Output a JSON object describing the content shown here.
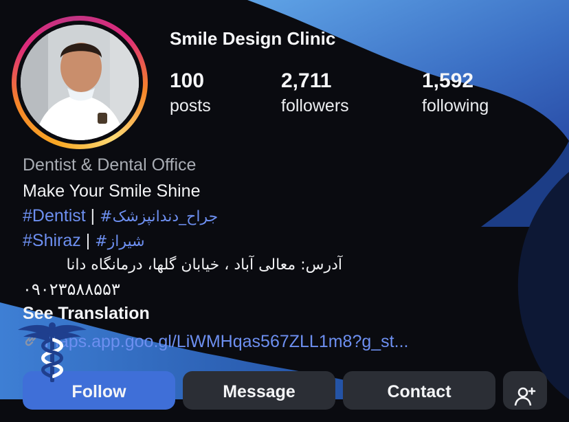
{
  "profile": {
    "name": "Smile Design Clinic",
    "stats": [
      {
        "value": "100",
        "label": "posts"
      },
      {
        "value": "2,711",
        "label": "followers"
      },
      {
        "value": "1,592",
        "label": "following"
      }
    ],
    "category": "Dentist & Dental Office",
    "bio_line1": "Make Your Smile Shine",
    "bio_line2": {
      "tag1": "#Dentist",
      "sep": "|",
      "tag2": "#جراح_دندانپزشک"
    },
    "bio_line3": {
      "tag1": "#Shiraz",
      "sep": "|",
      "tag2": "#شیراز"
    },
    "address": "آدرس: معالی آباد ، خیابان گلها، درمانگاه دانا",
    "phone": "۰۹۰۲۳۵۸۸۵۵۳",
    "see_translation": "See Translation",
    "link": "maps.app.goo.gl/LiWMHqas567ZLL1m8?g_st..."
  },
  "actions": {
    "follow": "Follow",
    "message": "Message",
    "contact": "Contact"
  },
  "icons": {
    "link": "link-icon",
    "add_person": "add-person-icon",
    "logo": "caduceus-icon"
  },
  "colors": {
    "background": "#0a0b10",
    "accent_blue": "#3f6fd8",
    "hashtag": "#6d8ff0",
    "button": "#2b2e35"
  }
}
